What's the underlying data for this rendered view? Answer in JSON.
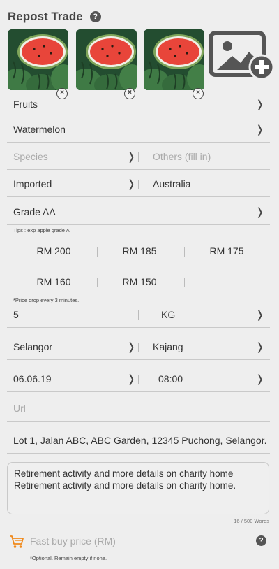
{
  "header": {
    "title": "Repost Trade",
    "help_glyph": "?"
  },
  "photos": {
    "remove_glyph": "×",
    "add_icon": "add-photo-icon"
  },
  "category": "Fruits",
  "product": "Watermelon",
  "species_placeholder": "Species",
  "others_placeholder": "Others (fill in)",
  "origin": "Imported",
  "country": "Australia",
  "grade": "Grade AA",
  "grade_tip": "Tips : exp apple grade A",
  "prices": {
    "p1": "RM 200",
    "p2": "RM 185",
    "p3": "RM 175",
    "p4": "RM 160",
    "p5": "RM 150"
  },
  "price_tip": "*Price drop every 3 minutes.",
  "quantity": "5",
  "unit": "KG",
  "state": "Selangor",
  "city": "Kajang",
  "date": "06.06.19",
  "time": "08:00",
  "url_placeholder": "Url",
  "address": "Lot 1, Jalan ABC, ABC Garden, 12345 Puchong, Selangor.",
  "description": "Retirement activity and more details on charity home Retirement activity and more details on charity home.",
  "word_count": "16 / 500 Words",
  "fast_buy_placeholder": "Fast buy price (RM)",
  "fast_buy_note": "*Optional. Remain empty if none.",
  "chevron": "❭",
  "colors": {
    "accent_orange": "#f08a1c",
    "text_dark": "#333333",
    "placeholder": "#aaaaaa",
    "background": "#eeeeee"
  }
}
